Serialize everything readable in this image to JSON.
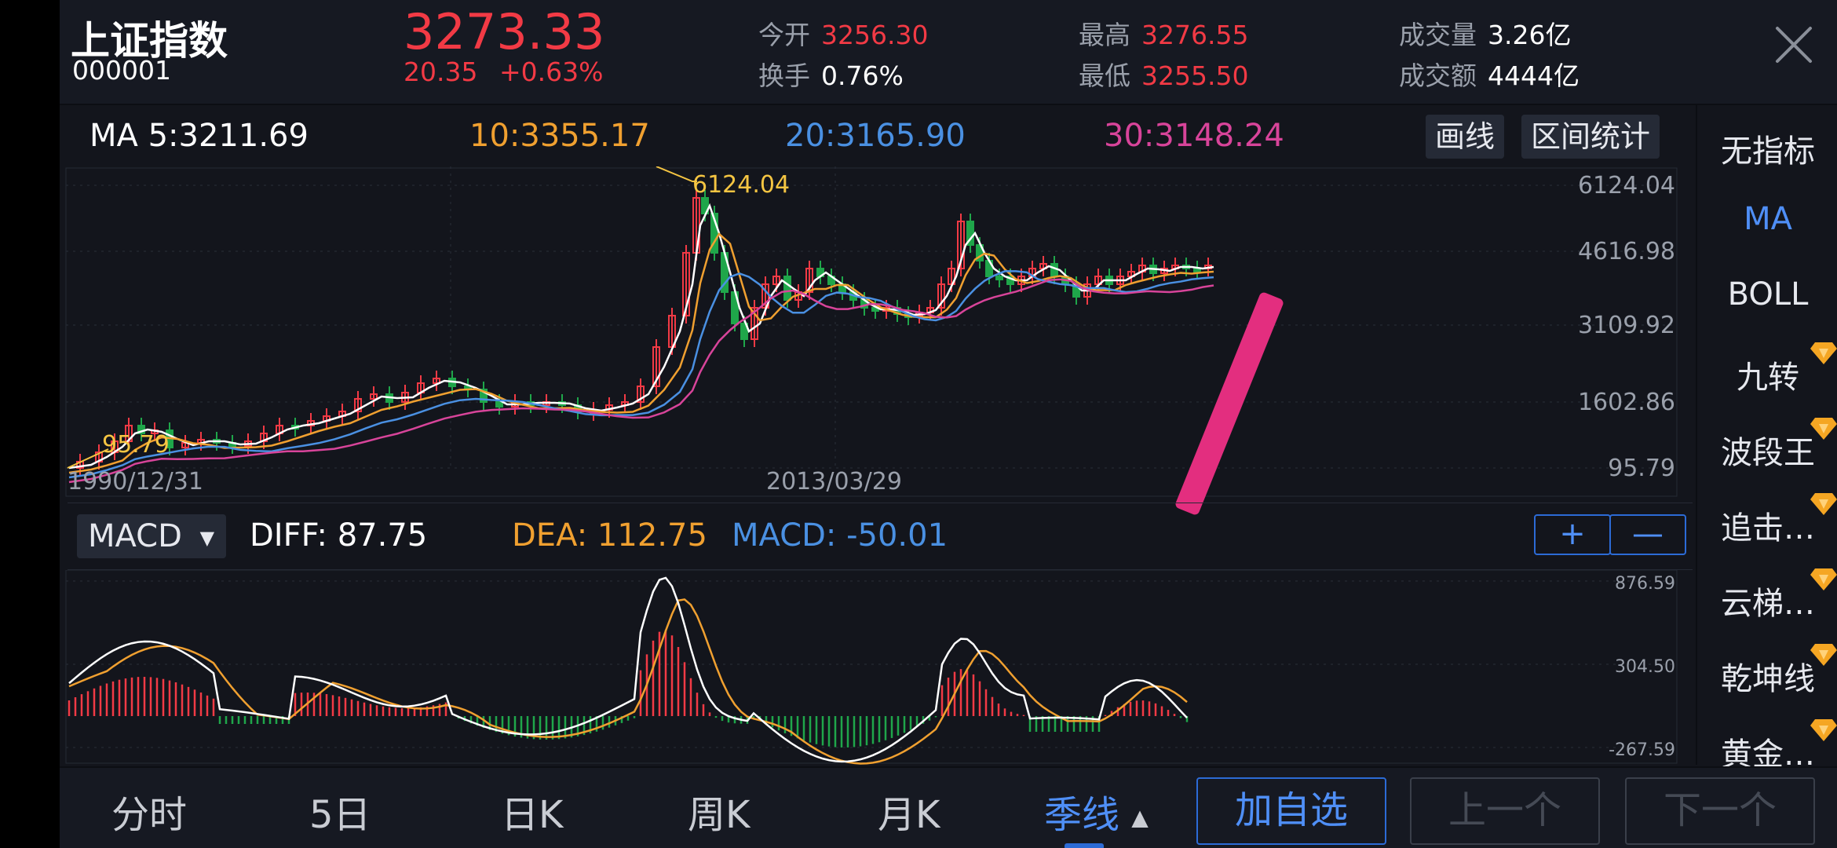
{
  "header": {
    "name": "上证指数",
    "code": "000001",
    "price": "3273.33",
    "change": "20.35",
    "change_pct": "+0.63%",
    "open_label": "今开",
    "open": "3256.30",
    "turnover_label": "换手",
    "turnover": "0.76%",
    "high_label": "最高",
    "high": "3276.55",
    "low_label": "最低",
    "low": "3255.50",
    "volume_label": "成交量",
    "volume": "3.26亿",
    "amount_label": "成交额",
    "amount": "4444亿"
  },
  "ma_bar": {
    "ma5": "MA 5:3211.69",
    "ma10": "10:3355.17",
    "ma20": "20:3165.90",
    "ma30": "30:3148.24",
    "draw_label": "画线",
    "range_stats_label": "区间统计"
  },
  "main_chart": {
    "y_ticks": [
      "6124.04",
      "4616.98",
      "3109.92",
      "1602.86",
      "95.79"
    ],
    "x_labels": [
      "1990/12/31",
      "2013/03/29"
    ],
    "max_label": "6124.04",
    "min_label": "95.79"
  },
  "macd_bar": {
    "indicator": "MACD",
    "diff": "DIFF: 87.75",
    "dea": "DEA: 112.75",
    "macd": "MACD: -50.01",
    "plus": "+",
    "minus": "—"
  },
  "macd_chart": {
    "y_ticks": [
      "876.59",
      "304.50",
      "-267.59"
    ]
  },
  "sidebar": {
    "items": [
      {
        "label": "无指标"
      },
      {
        "label": "MA"
      },
      {
        "label": "BOLL"
      },
      {
        "label": "九转"
      },
      {
        "label": "波段王"
      },
      {
        "label": "追击…"
      },
      {
        "label": "云梯…"
      },
      {
        "label": "乾坤线"
      },
      {
        "label": "黄金…"
      }
    ]
  },
  "tabs": {
    "items": [
      {
        "label": "分时"
      },
      {
        "label": "5日"
      },
      {
        "label": "日K"
      },
      {
        "label": "周K"
      },
      {
        "label": "月K"
      },
      {
        "label": "季线"
      }
    ],
    "add_watch": "加自选",
    "prev": "上一个",
    "next": "下一个"
  },
  "colors": {
    "up": "#f23a45",
    "down": "#1fa64a",
    "ma5": "#ffffff",
    "ma10": "#f0a030",
    "ma20": "#4a90e2",
    "ma30": "#d8449a",
    "accent": "#2c6bd6"
  },
  "chart_data": {
    "type": "line",
    "title": "",
    "series": [],
    "ylim": [
      95.79,
      6124.04
    ],
    "y_ticks": [
      6124.04,
      4616.98,
      3109.92,
      1602.86,
      95.79
    ],
    "x_start": "1990/12/31",
    "x_mid": "2013/03/29",
    "max": 6124.04,
    "min": 95.79
  }
}
